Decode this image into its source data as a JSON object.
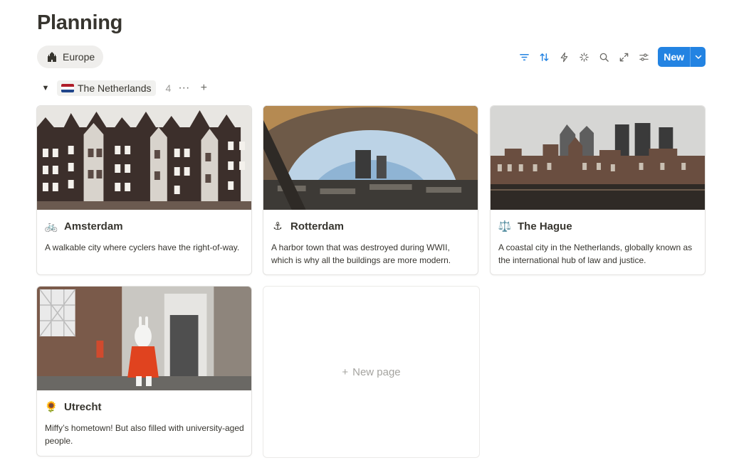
{
  "page": {
    "title": "Planning"
  },
  "view": {
    "label": "Europe",
    "icon": "castle-icon"
  },
  "toolbar": {
    "icons": [
      "filter-icon",
      "sort-icon",
      "automation-bolt-icon",
      "ai-sparkle-icon",
      "search-icon",
      "expand-icon",
      "settings-sliders-icon"
    ],
    "new_label": "New",
    "accent": "#2383e2"
  },
  "group": {
    "name": "The Netherlands",
    "count": "4",
    "more": "···",
    "add": "+",
    "toggle": "▼",
    "flag_colors": [
      "#ae1c28",
      "#ffffff",
      "#21468b"
    ]
  },
  "cards": [
    {
      "emoji": "🚲",
      "title": "Amsterdam",
      "description": "A walkable city where cyclers have the right-of-way.",
      "cover": "amsterdam canal houses photo"
    },
    {
      "emoji": "⚓",
      "title": "Rotterdam",
      "description": "A harbor town that was destroyed during WWII, which is why all the buildings are more modern.",
      "cover": "rotterdam market hall photo"
    },
    {
      "emoji": "⚖️",
      "title": "The Hague",
      "description": "A coastal city in the Netherlands, globally known as the international hub of law and justice.",
      "cover": "the hague skyline photo"
    },
    {
      "emoji": "🌻",
      "title": "Utrecht",
      "description": "Miffy’s hometown! But also filled with university-aged people.",
      "cover": "utrecht miffy statue photo"
    }
  ],
  "new_page": {
    "plus": "+",
    "label": "New page"
  }
}
